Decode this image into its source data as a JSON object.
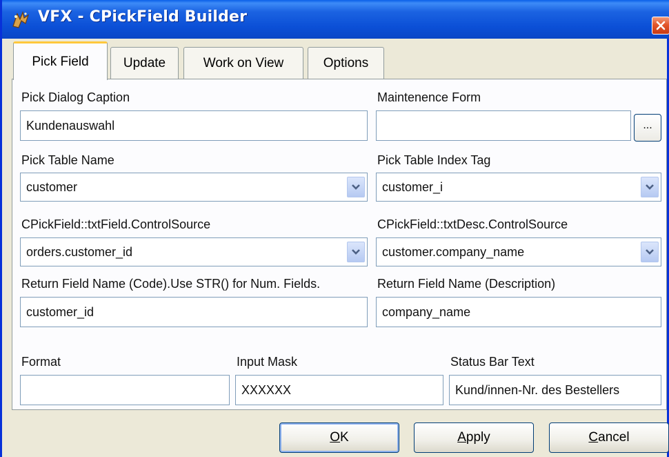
{
  "window": {
    "title": "VFX - CPickField Builder"
  },
  "tabs": [
    {
      "label": "Pick Field",
      "active": true
    },
    {
      "label": "Update",
      "active": false
    },
    {
      "label": "Work on View",
      "active": false
    },
    {
      "label": "Options",
      "active": false
    }
  ],
  "form": {
    "pick_dialog_caption": {
      "label": "Pick Dialog Caption",
      "value": "Kundenauswahl"
    },
    "maintenance_form": {
      "label": "Maintenence Form",
      "value": "",
      "browse_label": "..."
    },
    "pick_table_name": {
      "label": "Pick Table Name",
      "value": "customer"
    },
    "pick_table_index_tag": {
      "label": "Pick Table  Index Tag",
      "value": "customer_i"
    },
    "txtfield_controlsource": {
      "label": "CPickField::txtField.ControlSource",
      "value": "orders.customer_id"
    },
    "txtdesc_controlsource": {
      "label": "CPickField::txtDesc.ControlSource",
      "value": "customer.company_name"
    },
    "return_field_code": {
      "label": "Return Field Name (Code).Use STR() for Num. Fields.",
      "value": "customer_id"
    },
    "return_field_desc": {
      "label": "Return Field Name (Description)",
      "value": "company_name"
    },
    "format": {
      "label": "Format",
      "value": ""
    },
    "input_mask": {
      "label": "Input Mask",
      "value": "XXXXXX"
    },
    "status_bar_text": {
      "label": "Status Bar Text",
      "value": "Kund/innen-Nr. des Bestellers"
    }
  },
  "buttons": {
    "ok": {
      "mnemonic": "O",
      "rest": "K"
    },
    "apply": {
      "mnemonic": "A",
      "rest": "pply"
    },
    "cancel": {
      "mnemonic": "C",
      "rest": "ancel"
    }
  },
  "colors": {
    "title_bar": "#0b4fd6",
    "close_button": "#e3562b",
    "active_tab_accent": "#ffc83c",
    "field_border": "#7f9db9"
  }
}
